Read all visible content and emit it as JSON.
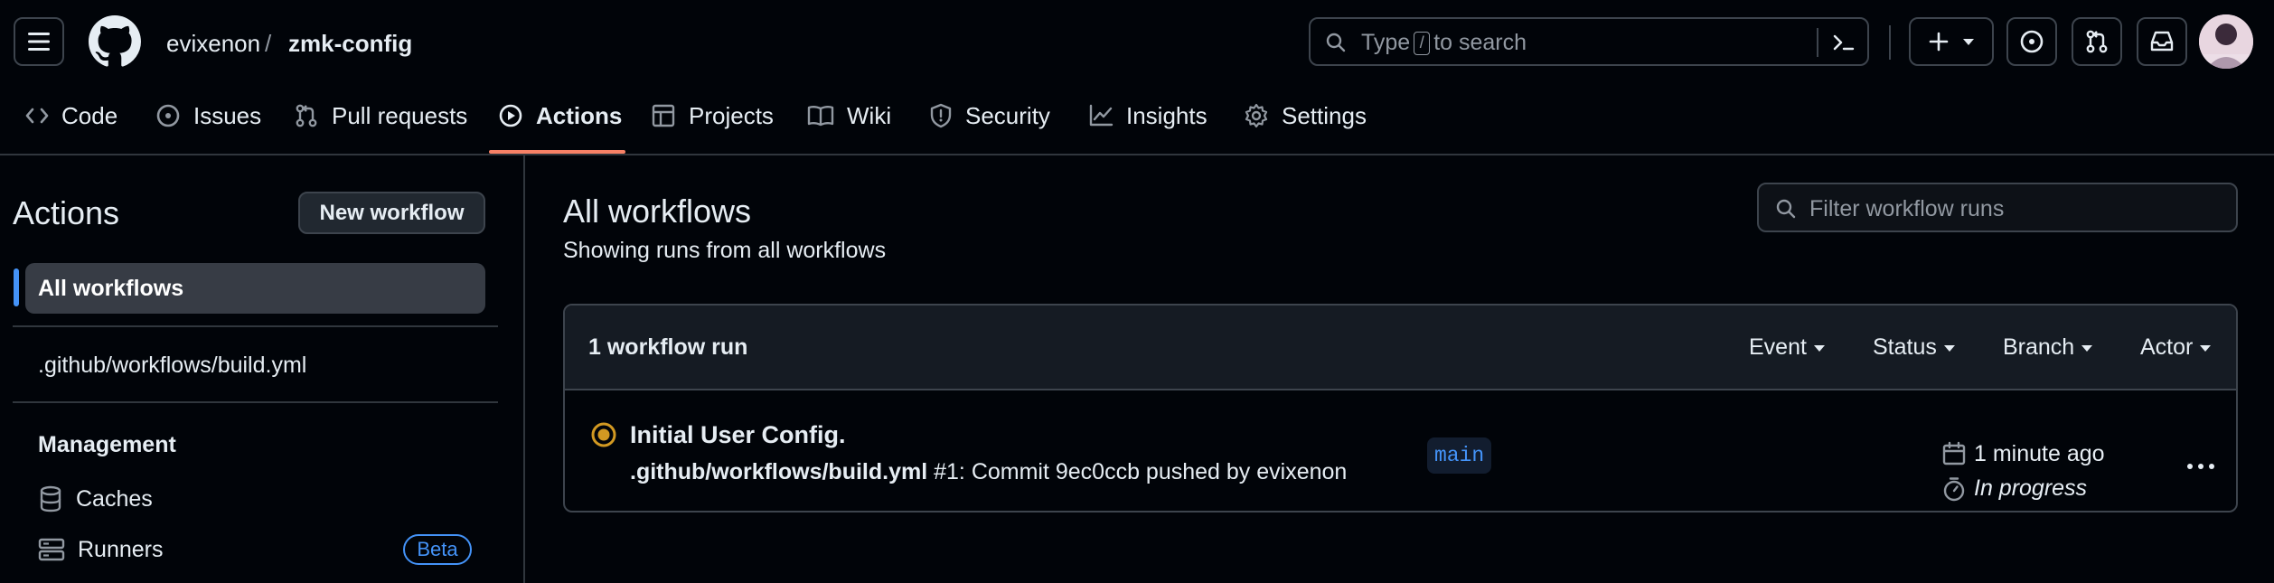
{
  "header": {
    "owner": "evixenon",
    "separator": "/",
    "repo": "zmk-config",
    "search": {
      "prefix": "Type",
      "key": "/",
      "suffix": "to search"
    }
  },
  "tabs": [
    {
      "label": "Code",
      "icon": "code-icon"
    },
    {
      "label": "Issues",
      "icon": "issue-opened-icon"
    },
    {
      "label": "Pull requests",
      "icon": "git-pull-request-icon"
    },
    {
      "label": "Actions",
      "icon": "play-icon",
      "active": true
    },
    {
      "label": "Projects",
      "icon": "table-icon"
    },
    {
      "label": "Wiki",
      "icon": "book-icon"
    },
    {
      "label": "Security",
      "icon": "shield-icon"
    },
    {
      "label": "Insights",
      "icon": "graph-icon"
    },
    {
      "label": "Settings",
      "icon": "gear-icon"
    }
  ],
  "sidebar": {
    "title": "Actions",
    "new_workflow": "New workflow",
    "all_workflows": "All workflows",
    "workflow_file": ".github/workflows/build.yml",
    "management_heading": "Management",
    "caches": "Caches",
    "runners": "Runners",
    "runners_badge": "Beta"
  },
  "main": {
    "title": "All workflows",
    "subtitle": "Showing runs from all workflows",
    "filter_placeholder": "Filter workflow runs",
    "runs_count": "1 workflow run",
    "filters": {
      "event": "Event",
      "status": "Status",
      "branch": "Branch",
      "actor": "Actor"
    },
    "run": {
      "title": "Initial User Config.",
      "workflow": ".github/workflows/build.yml",
      "meta_rest": " #1: Commit 9ec0ccb pushed by evixenon",
      "branch": "main",
      "time": "1 minute ago",
      "status": "In progress",
      "status_color": "#d29922"
    }
  },
  "colors": {
    "accent": "#f78166",
    "link": "#4493f8",
    "in_progress": "#d29922"
  }
}
